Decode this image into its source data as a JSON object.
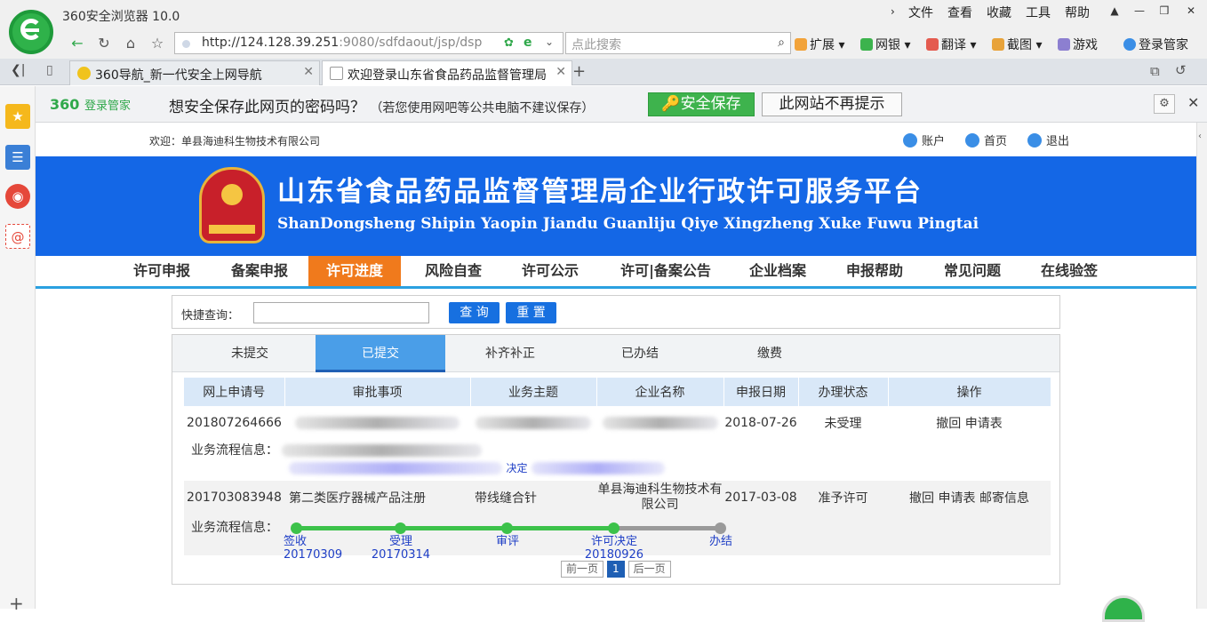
{
  "browser": {
    "title": "360安全浏览器 10.0",
    "menus": [
      "文件",
      "查看",
      "收藏",
      "工具",
      "帮助"
    ],
    "url_host": "http://124.128.39.251",
    "url_rest": ":9080/sdfdaout/jsp/dsp",
    "search_placeholder": "点此搜索",
    "extensions": [
      "扩展",
      "网银",
      "翻译",
      "截图",
      "游戏",
      "登录管家"
    ],
    "tabs": [
      {
        "label": "360导航_新一代安全上网导航",
        "active": false
      },
      {
        "label": "欢迎登录山东省食品药品监督管理局",
        "active": true
      }
    ]
  },
  "password_bar": {
    "brand": "360",
    "brand_sub": "登录管家",
    "message": "想安全保存此网页的密码吗？",
    "note": "（若您使用网吧等公共电脑不建议保存）",
    "save_label": "安全保存",
    "no_label": "此网站不再提示"
  },
  "site": {
    "welcome": "欢迎：单县海迪科生物技术有限公司",
    "top_links": [
      "账户",
      "首页",
      "退出"
    ],
    "banner_title": "山东省食品药品监督管理局企业行政许可服务平台",
    "banner_subtitle": "ShanDongsheng Shipin Yaopin Jiandu Guanliju Qiye Xingzheng Xuke Fuwu Pingtai",
    "nav": [
      "许可申报",
      "备案申报",
      "许可进度",
      "风险自查",
      "许可公示",
      "许可|备案公告",
      "企业档案",
      "申报帮助",
      "常见问题",
      "在线验签"
    ],
    "nav_active_index": 2
  },
  "quick_search": {
    "label": "快捷查询：",
    "value": "",
    "query_label": "查 询",
    "reset_label": "重 置"
  },
  "subtabs": [
    "未提交",
    "已提交",
    "补齐补正",
    "已办结",
    "缴费"
  ],
  "subtab_active_index": 1,
  "table": {
    "headers": [
      "网上申请号",
      "审批事项",
      "业务主题",
      "企业名称",
      "申报日期",
      "办理状态",
      "操作"
    ],
    "rows": [
      {
        "id": "201807264666",
        "item": "",
        "topic": "",
        "company": "",
        "date": "2018-07-26",
        "status": "未受理",
        "actions": "撤回 申请表",
        "flow_label": "业务流程信息：",
        "flow_visible": "决定"
      },
      {
        "id": "201703083948",
        "item": "第二类医疗器械产品注册",
        "topic": "带线缝合针",
        "company": "单县海迪科生物技术有限公司",
        "date": "2017-03-08",
        "status": "准予许可",
        "actions": "撤回 申请表 邮寄信息",
        "flow_label": "业务流程信息：",
        "flow_steps": [
          {
            "name": "签收",
            "date": "20170309",
            "done": true
          },
          {
            "name": "受理",
            "date": "20170314",
            "done": true
          },
          {
            "name": "审评",
            "date": "",
            "done": true
          },
          {
            "name": "许可决定",
            "date": "20180926",
            "done": true
          },
          {
            "name": "办结",
            "date": "",
            "done": false
          }
        ]
      }
    ]
  },
  "pager": {
    "prev": "前一页",
    "current": "1",
    "next": "后一页"
  },
  "colors": {
    "banner": "#1467e6",
    "nav_active": "#f07a1c",
    "flow_done": "#3cc24a",
    "flow_pending": "#9a9a9a",
    "status_ok": "#2e9a2e"
  }
}
